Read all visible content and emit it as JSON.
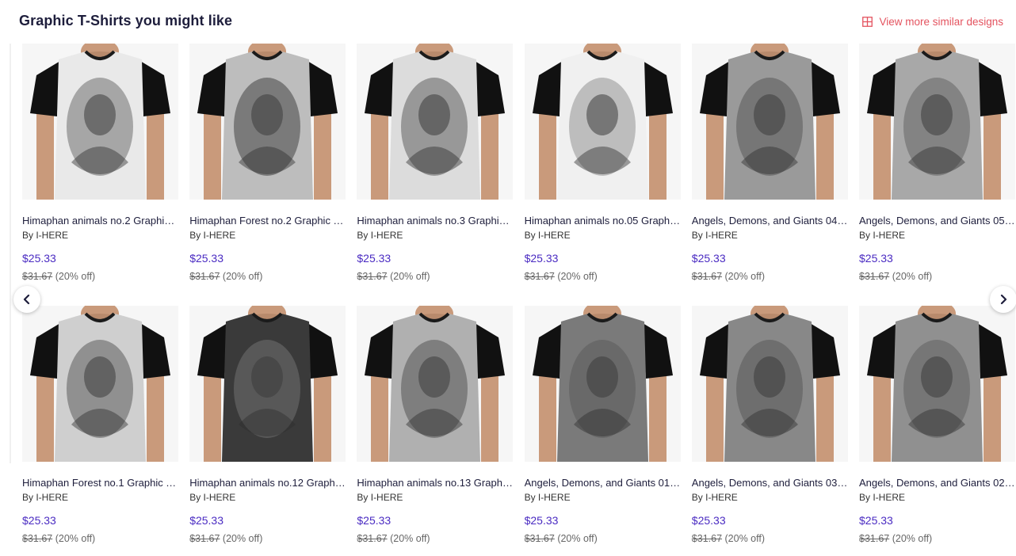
{
  "header": {
    "title": "Graphic T-Shirts you might like",
    "view_more_label": "View more similar designs"
  },
  "colors": {
    "accent": "#e4535f",
    "price": "#4a2bc2",
    "title": "#1e1e3c"
  },
  "nav": {
    "prev_icon": "chevron-left-icon",
    "next_icon": "chevron-right-icon"
  },
  "products": [
    {
      "title": "Himaphan animals no.2 Graphic ...",
      "by": "By I-HERE",
      "price": "$25.33",
      "old_price": "$31.67",
      "discount": "(20% off)"
    },
    {
      "title": "Himaphan Forest no.2 Graphic T...",
      "by": "By I-HERE",
      "price": "$25.33",
      "old_price": "$31.67",
      "discount": "(20% off)"
    },
    {
      "title": "Himaphan animals no.3 Graphic ...",
      "by": "By I-HERE",
      "price": "$25.33",
      "old_price": "$31.67",
      "discount": "(20% off)"
    },
    {
      "title": "Himaphan animals no.05 Graphi...",
      "by": "By I-HERE",
      "price": "$25.33",
      "old_price": "$31.67",
      "discount": "(20% off)"
    },
    {
      "title": "Angels, Demons, and Giants 04 ...",
      "by": "By I-HERE",
      "price": "$25.33",
      "old_price": "$31.67",
      "discount": "(20% off)"
    },
    {
      "title": "Angels, Demons, and Giants 05 ...",
      "by": "By I-HERE",
      "price": "$25.33",
      "old_price": "$31.67",
      "discount": "(20% off)"
    },
    {
      "title": "Himaphan Forest no.1 Graphic T...",
      "by": "By I-HERE",
      "price": "$25.33",
      "old_price": "$31.67",
      "discount": "(20% off)"
    },
    {
      "title": "Himaphan animals no.12 Graphi...",
      "by": "By I-HERE",
      "price": "$25.33",
      "old_price": "$31.67",
      "discount": "(20% off)"
    },
    {
      "title": "Himaphan animals no.13 Graphi...",
      "by": "By I-HERE",
      "price": "$25.33",
      "old_price": "$31.67",
      "discount": "(20% off)"
    },
    {
      "title": "Angels, Demons, and Giants 01 ...",
      "by": "By I-HERE",
      "price": "$25.33",
      "old_price": "$31.67",
      "discount": "(20% off)"
    },
    {
      "title": "Angels, Demons, and Giants 03 ...",
      "by": "By I-HERE",
      "price": "$25.33",
      "old_price": "$31.67",
      "discount": "(20% off)"
    },
    {
      "title": "Angels, Demons, and Giants 02 ...",
      "by": "By I-HERE",
      "price": "$25.33",
      "old_price": "$31.67",
      "discount": "(20% off)"
    }
  ]
}
